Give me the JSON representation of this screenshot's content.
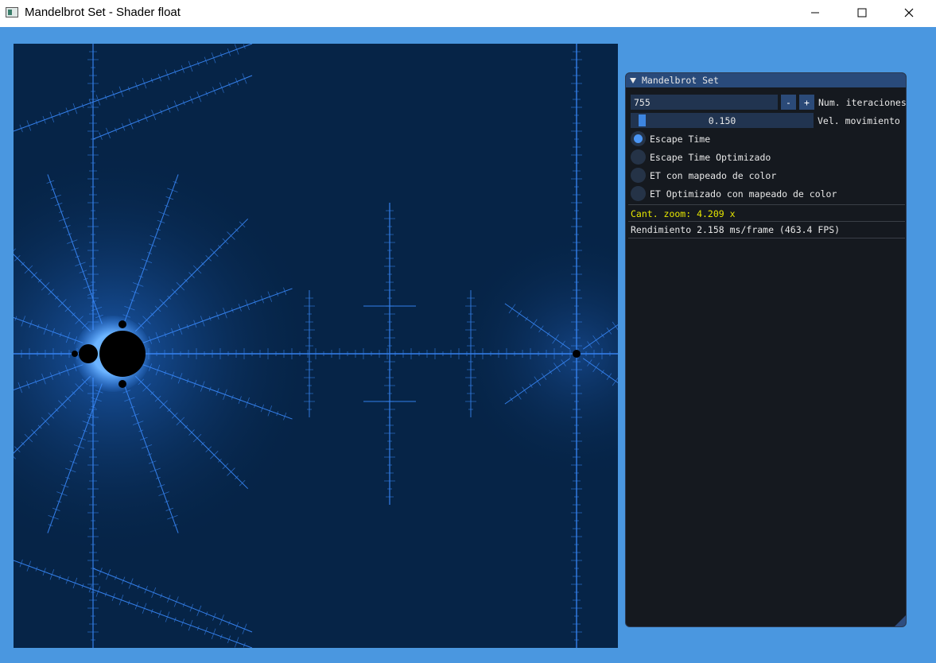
{
  "window": {
    "title": "Mandelbrot Set - Shader float"
  },
  "panel": {
    "title": "Mandelbrot Set",
    "iterations": {
      "value": "755",
      "minus": "-",
      "plus": "+",
      "label": "Num. iteraciones"
    },
    "speed": {
      "value": "0.150",
      "fraction": 0.04,
      "label": "Vel. movimiento"
    },
    "modes": [
      {
        "label": "Escape Time",
        "selected": true
      },
      {
        "label": "Escape Time Optimizado",
        "selected": false
      },
      {
        "label": "ET con mapeado de color",
        "selected": false
      },
      {
        "label": "ET Optimizado con mapeado de color",
        "selected": false
      }
    ],
    "zoom_text": "Cant. zoom: 4.209 x",
    "perf_text": "Rendimiento 2.158 ms/frame (463.4 FPS)"
  },
  "colors": {
    "accent": "#4b96f5",
    "zoom_text": "#e6e600",
    "set": "#000000",
    "background": "#062447",
    "glow": "#3b8cff"
  }
}
